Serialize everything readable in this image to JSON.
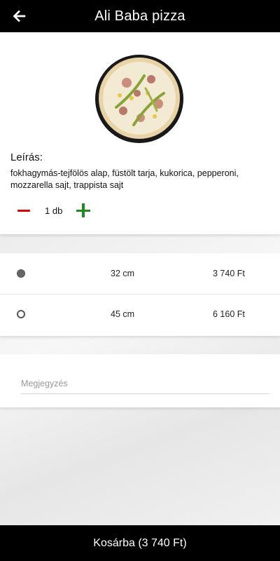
{
  "header": {
    "title": "Ali Baba pizza",
    "back_icon": "arrow-left-icon"
  },
  "product": {
    "description_label": "Leírás:",
    "description": "fokhagymás-tejfölös alap, füstölt tarja, kukorica, pepperoni, mozzarella sajt, trappista sajt",
    "quantity_label": "1 db"
  },
  "sizes": [
    {
      "size": "32 cm",
      "price": "3 740 Ft",
      "selected": true
    },
    {
      "size": "45 cm",
      "price": "6 160 Ft",
      "selected": false
    }
  ],
  "note": {
    "placeholder": "Megjegyzés",
    "value": ""
  },
  "cart_button": {
    "label": "Kosárba (3 740 Ft)"
  },
  "colors": {
    "minus": "#e00000",
    "plus": "#1f8a1f",
    "bars": "#000000"
  }
}
